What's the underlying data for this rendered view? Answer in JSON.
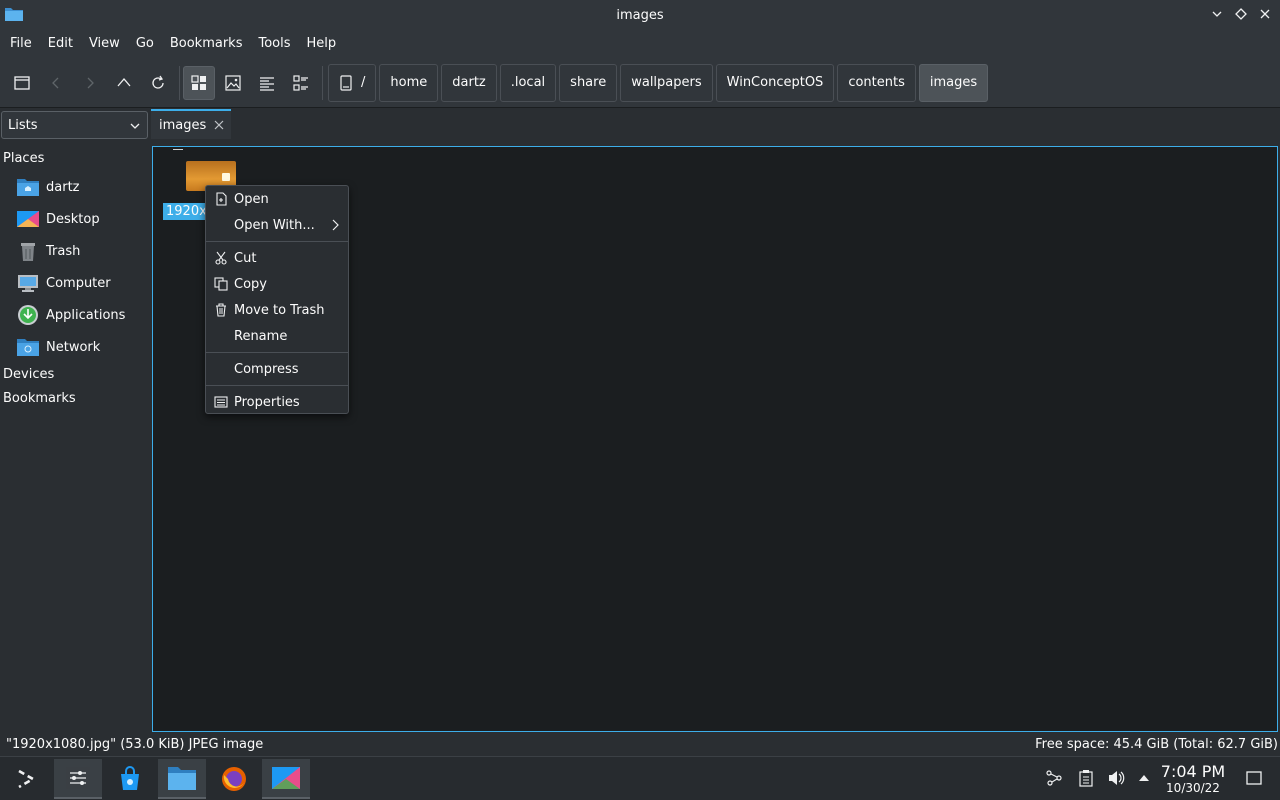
{
  "window": {
    "title": "images"
  },
  "menubar": {
    "items": [
      "File",
      "Edit",
      "View",
      "Go",
      "Bookmarks",
      "Tools",
      "Help"
    ]
  },
  "breadcrumb": {
    "root": "/",
    "items": [
      "home",
      "dartz",
      ".local",
      "share",
      "wallpapers",
      "WinConceptOS",
      "contents",
      "images"
    ]
  },
  "sidebar": {
    "panel_select": "Lists",
    "places_heading": "Places",
    "places": [
      {
        "label": "dartz",
        "icon": "home-folder-icon"
      },
      {
        "label": "Desktop",
        "icon": "desktop-icon"
      },
      {
        "label": "Trash",
        "icon": "trash-icon"
      },
      {
        "label": "Computer",
        "icon": "computer-icon"
      },
      {
        "label": "Applications",
        "icon": "applications-icon"
      },
      {
        "label": "Network",
        "icon": "network-folder-icon"
      }
    ],
    "devices_heading": "Devices",
    "bookmarks_heading": "Bookmarks"
  },
  "tabs": [
    {
      "label": "images"
    }
  ],
  "view": {
    "file_label": "1920x1080.jpg"
  },
  "context_menu": {
    "open": "Open",
    "open_with": "Open With...",
    "cut": "Cut",
    "copy": "Copy",
    "move_to_trash": "Move to Trash",
    "rename": "Rename",
    "compress": "Compress",
    "properties": "Properties"
  },
  "statusbar": {
    "selection": "\"1920x1080.jpg\" (53.0 KiB) JPEG image",
    "free_space": "Free space: 45.4 GiB (Total: 62.7 GiB)"
  },
  "taskbar": {
    "time": "7:04 PM",
    "date": "10/30/22"
  },
  "colors": {
    "accent": "#3daee9",
    "background": "#1b1e20",
    "panel": "#31363b"
  }
}
